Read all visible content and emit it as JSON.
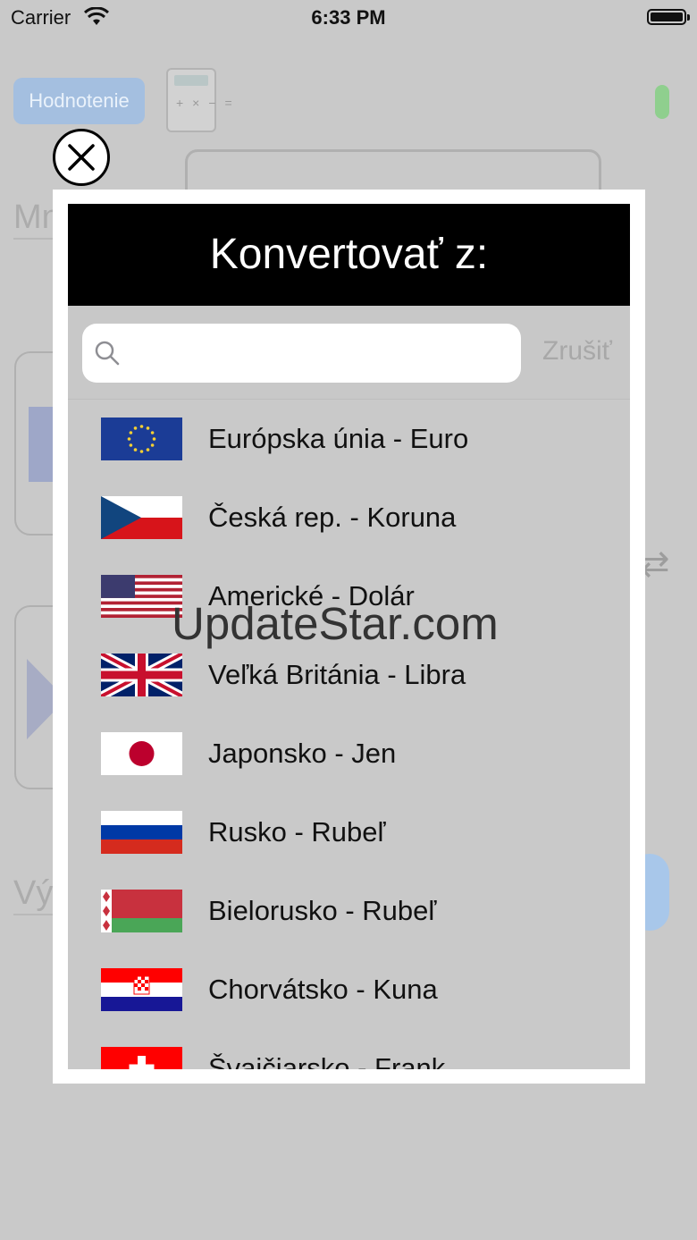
{
  "status_bar": {
    "carrier": "Carrier",
    "time": "6:33 PM"
  },
  "background": {
    "rating_label": "Hodnotenie",
    "field_top_label": "Mn",
    "field_bottom_label": "Vý"
  },
  "modal": {
    "title": "Konvertovať z:",
    "search": {
      "placeholder": "",
      "value": "",
      "cancel_label": "Zrušiť"
    },
    "currencies": [
      {
        "label": "Európska únia - Euro",
        "flag": "eu"
      },
      {
        "label": "Česká rep. - Koruna",
        "flag": "cz"
      },
      {
        "label": "Americké - Dolár",
        "flag": "us"
      },
      {
        "label": "Veľká Británia - Libra",
        "flag": "gb"
      },
      {
        "label": "Japonsko - Jen",
        "flag": "jp"
      },
      {
        "label": "Rusko - Rubeľ",
        "flag": "ru"
      },
      {
        "label": "Bielorusko - Rubeľ",
        "flag": "by"
      },
      {
        "label": "Chorvátsko - Kuna",
        "flag": "hr"
      },
      {
        "label": "Švajčiarsko - Frank",
        "flag": "ch"
      }
    ]
  },
  "watermark": "UpdateStar.com"
}
